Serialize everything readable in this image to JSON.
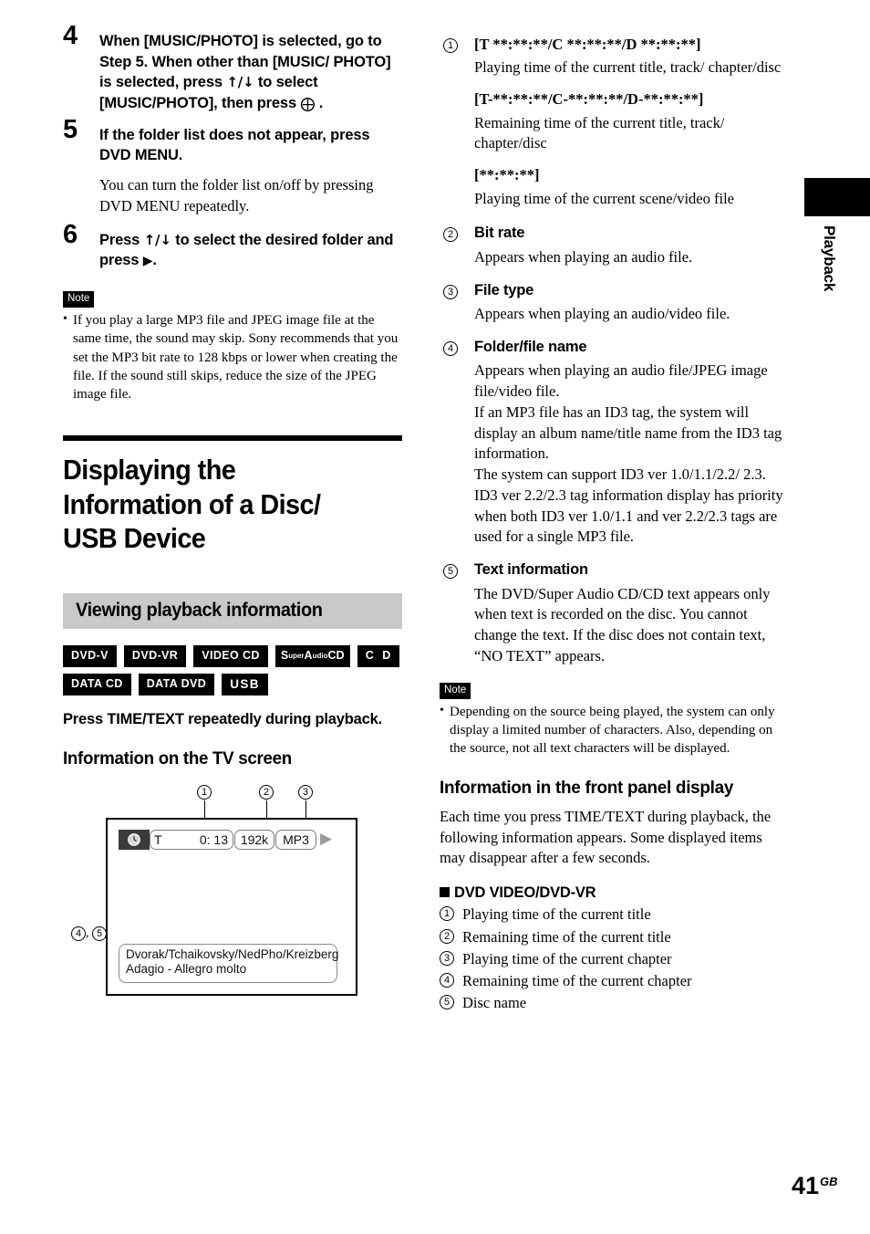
{
  "page": {
    "number": "41",
    "region_code": "GB",
    "side_tab_label": "Playback"
  },
  "left_column": {
    "steps": [
      {
        "number": "4",
        "heading_parts": {
          "a": "When [MUSIC/PHOTO] is selected, go to Step 5. When other than [MUSIC/ PHOTO] is selected, press ",
          "arrows": "↑/↓",
          "b": " to select [MUSIC/PHOTO], then press ",
          "enter": "⨁",
          "c": " ."
        },
        "body": ""
      },
      {
        "number": "5",
        "heading_parts": {
          "a": "If the folder list does not appear, press DVD MENU.",
          "arrows": "",
          "b": "",
          "enter": "",
          "c": ""
        },
        "body": "You can turn the folder list on/off by pressing DVD MENU repeatedly."
      },
      {
        "number": "6",
        "heading_parts": {
          "a": "Press ",
          "arrows": "↑/↓",
          "b": " to select the desired folder and press ",
          "enter": "▶",
          "c": "."
        },
        "body": ""
      }
    ],
    "note": {
      "badge": "Note",
      "items": [
        "If you play a large MP3 file and JPEG image file at the same time, the sound may skip. Sony recommends that you set the MP3 bit rate to 128 kbps or lower when creating the file. If the sound still skips, reduce the size of the JPEG image file."
      ]
    },
    "section_title": "Displaying the Information of a Disc/ USB Device",
    "subsection_title": "Viewing playback information",
    "disc_badges": [
      [
        {
          "id": "dvd-v",
          "label": "DVD-V"
        },
        {
          "id": "dvd-vr",
          "label": "DVD-VR"
        },
        {
          "id": "video-cd",
          "label": "VIDEO CD"
        },
        {
          "id": "super-audio-cd",
          "label": "SuperAudioCD",
          "parts": [
            "S",
            "uper",
            "A",
            "udio",
            "CD"
          ]
        },
        {
          "id": "cd",
          "label": "C D"
        }
      ],
      [
        {
          "id": "data-cd",
          "label": "DATA CD"
        },
        {
          "id": "data-dvd",
          "label": "DATA DVD"
        },
        {
          "id": "usb",
          "label": "USB"
        }
      ]
    ],
    "lead_instruction": "Press TIME/TEXT repeatedly during playback.",
    "tv_heading": "Information on the TV screen",
    "figure": {
      "callouts": {
        "one": "1",
        "two": "2",
        "three": "3",
        "four_five": "4, 5"
      },
      "osd": {
        "clock_icon": "clock-icon",
        "time_label": "T",
        "time_value": "0: 13",
        "bit_rate": "192k",
        "file_type": "MP3",
        "play_icon": "▶"
      },
      "text_box": {
        "line1": "Dvorak/Tchaikovsky/NedPho/Kreizberg",
        "line2": "Adagio - Allegro molto"
      }
    }
  },
  "right_column": {
    "items": [
      {
        "marker": "1",
        "title_serif": "[T **:**:**/C **:**:**/D **:**:**]",
        "descs": [
          "Playing time of the current title, track/ chapter/disc"
        ],
        "extra_blocks": [
          {
            "title": "[T-**:**:**/C-**:**:**/D-**:**:**]",
            "descs": [
              "Remaining time of the current title, track/ chapter/disc"
            ]
          },
          {
            "title": "[**:**:**]",
            "descs": [
              "Playing time of the current scene/video file"
            ]
          }
        ]
      },
      {
        "marker": "2",
        "title": "Bit rate",
        "descs": [
          "Appears when playing an audio file."
        ]
      },
      {
        "marker": "3",
        "title": "File type",
        "descs": [
          "Appears when playing an audio/video file."
        ]
      },
      {
        "marker": "4",
        "title": "Folder/file name",
        "descs": [
          "Appears when playing an audio file/JPEG image file/video file.",
          "If an MP3 file has an ID3 tag, the system will display an album name/title name from the ID3 tag information.",
          "The system can support ID3 ver 1.0/1.1/2.2/ 2.3.",
          "ID3 ver 2.2/2.3 tag information display has priority when both ID3 ver 1.0/1.1 and ver 2.2/2.3 tags are used for a single MP3 file."
        ]
      },
      {
        "marker": "5",
        "title": "Text information",
        "descs": [
          "The DVD/Super Audio CD/CD text appears only when text is recorded on the disc. You cannot change the text. If the disc does not contain text, “NO TEXT” appears."
        ]
      }
    ],
    "note": {
      "badge": "Note",
      "items": [
        "Depending on the source being played, the system can only display a limited number of characters. Also, depending on the source, not all text characters will be displayed."
      ]
    },
    "front_panel_heading": "Information in the front panel display",
    "front_panel_para": "Each time you press TIME/TEXT during playback, the following information appears. Some displayed items may disappear after a few seconds.",
    "dvd_subhead": "DVD VIDEO/DVD-VR",
    "dvd_list": [
      {
        "marker": "1",
        "text": "Playing time of the current title"
      },
      {
        "marker": "2",
        "text": "Remaining time of the current title"
      },
      {
        "marker": "3",
        "text": "Playing time of the current chapter"
      },
      {
        "marker": "4",
        "text": "Remaining time of the current chapter"
      },
      {
        "marker": "5",
        "text": "Disc name"
      }
    ]
  }
}
